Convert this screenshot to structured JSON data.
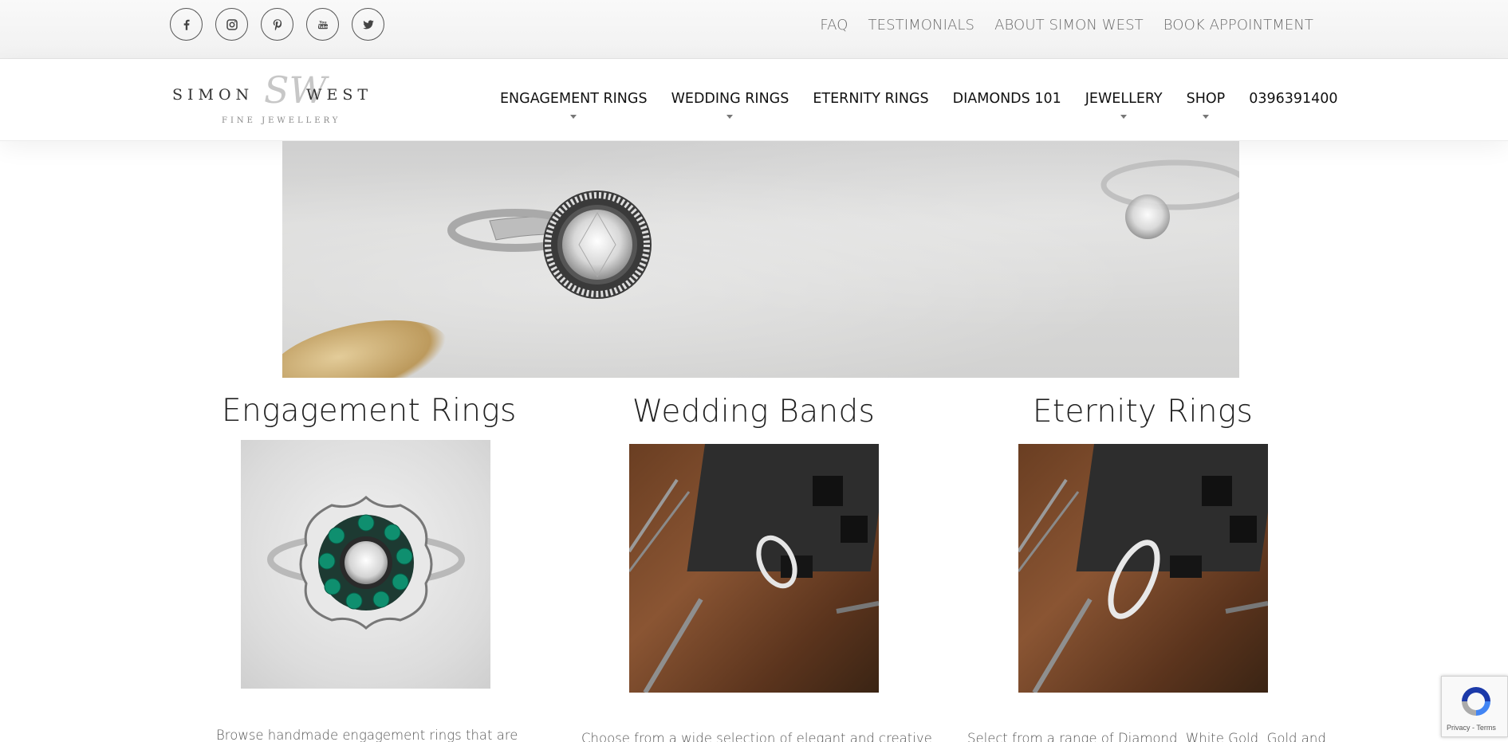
{
  "topbar": {
    "social": [
      {
        "icon": "facebook-icon",
        "glyph": "f"
      },
      {
        "icon": "instagram-icon",
        "glyph": ""
      },
      {
        "icon": "pinterest-icon",
        "glyph": "P"
      },
      {
        "icon": "youtube-icon",
        "glyph": ""
      },
      {
        "icon": "twitter-icon",
        "glyph": ""
      }
    ],
    "links": [
      "FAQ",
      "TESTIMONIALS",
      "ABOUT SIMON WEST",
      "BOOK APPOINTMENT"
    ]
  },
  "logo": {
    "left": "SIMON",
    "right": "WEST",
    "monogram": "SW",
    "subtitle": "FINE JEWELLERY"
  },
  "nav": {
    "items": [
      {
        "label": "ENGAGEMENT RINGS",
        "has_dropdown": true
      },
      {
        "label": "WEDDING RINGS",
        "has_dropdown": true
      },
      {
        "label": "ETERNITY RINGS",
        "has_dropdown": false
      },
      {
        "label": "DIAMONDS 101",
        "has_dropdown": false
      },
      {
        "label": "JEWELLERY",
        "has_dropdown": true
      },
      {
        "label": "SHOP",
        "has_dropdown": true
      },
      {
        "label": "0396391400",
        "has_dropdown": false
      }
    ]
  },
  "sections": [
    {
      "title": "Engagement Rings",
      "text": "Browse handmade engagement rings that are"
    },
    {
      "title": "Wedding Bands",
      "text": "Choose from a wide selection of elegant and creative"
    },
    {
      "title": "Eternity Rings",
      "text": "Select from a range of Diamond, White Gold, Gold and"
    }
  ],
  "recaptcha": {
    "terms": "Privacy - Terms"
  },
  "colors": {
    "topbar_bg": "#f4f4f4",
    "text": "#222222",
    "muted": "#6b6b6b"
  }
}
